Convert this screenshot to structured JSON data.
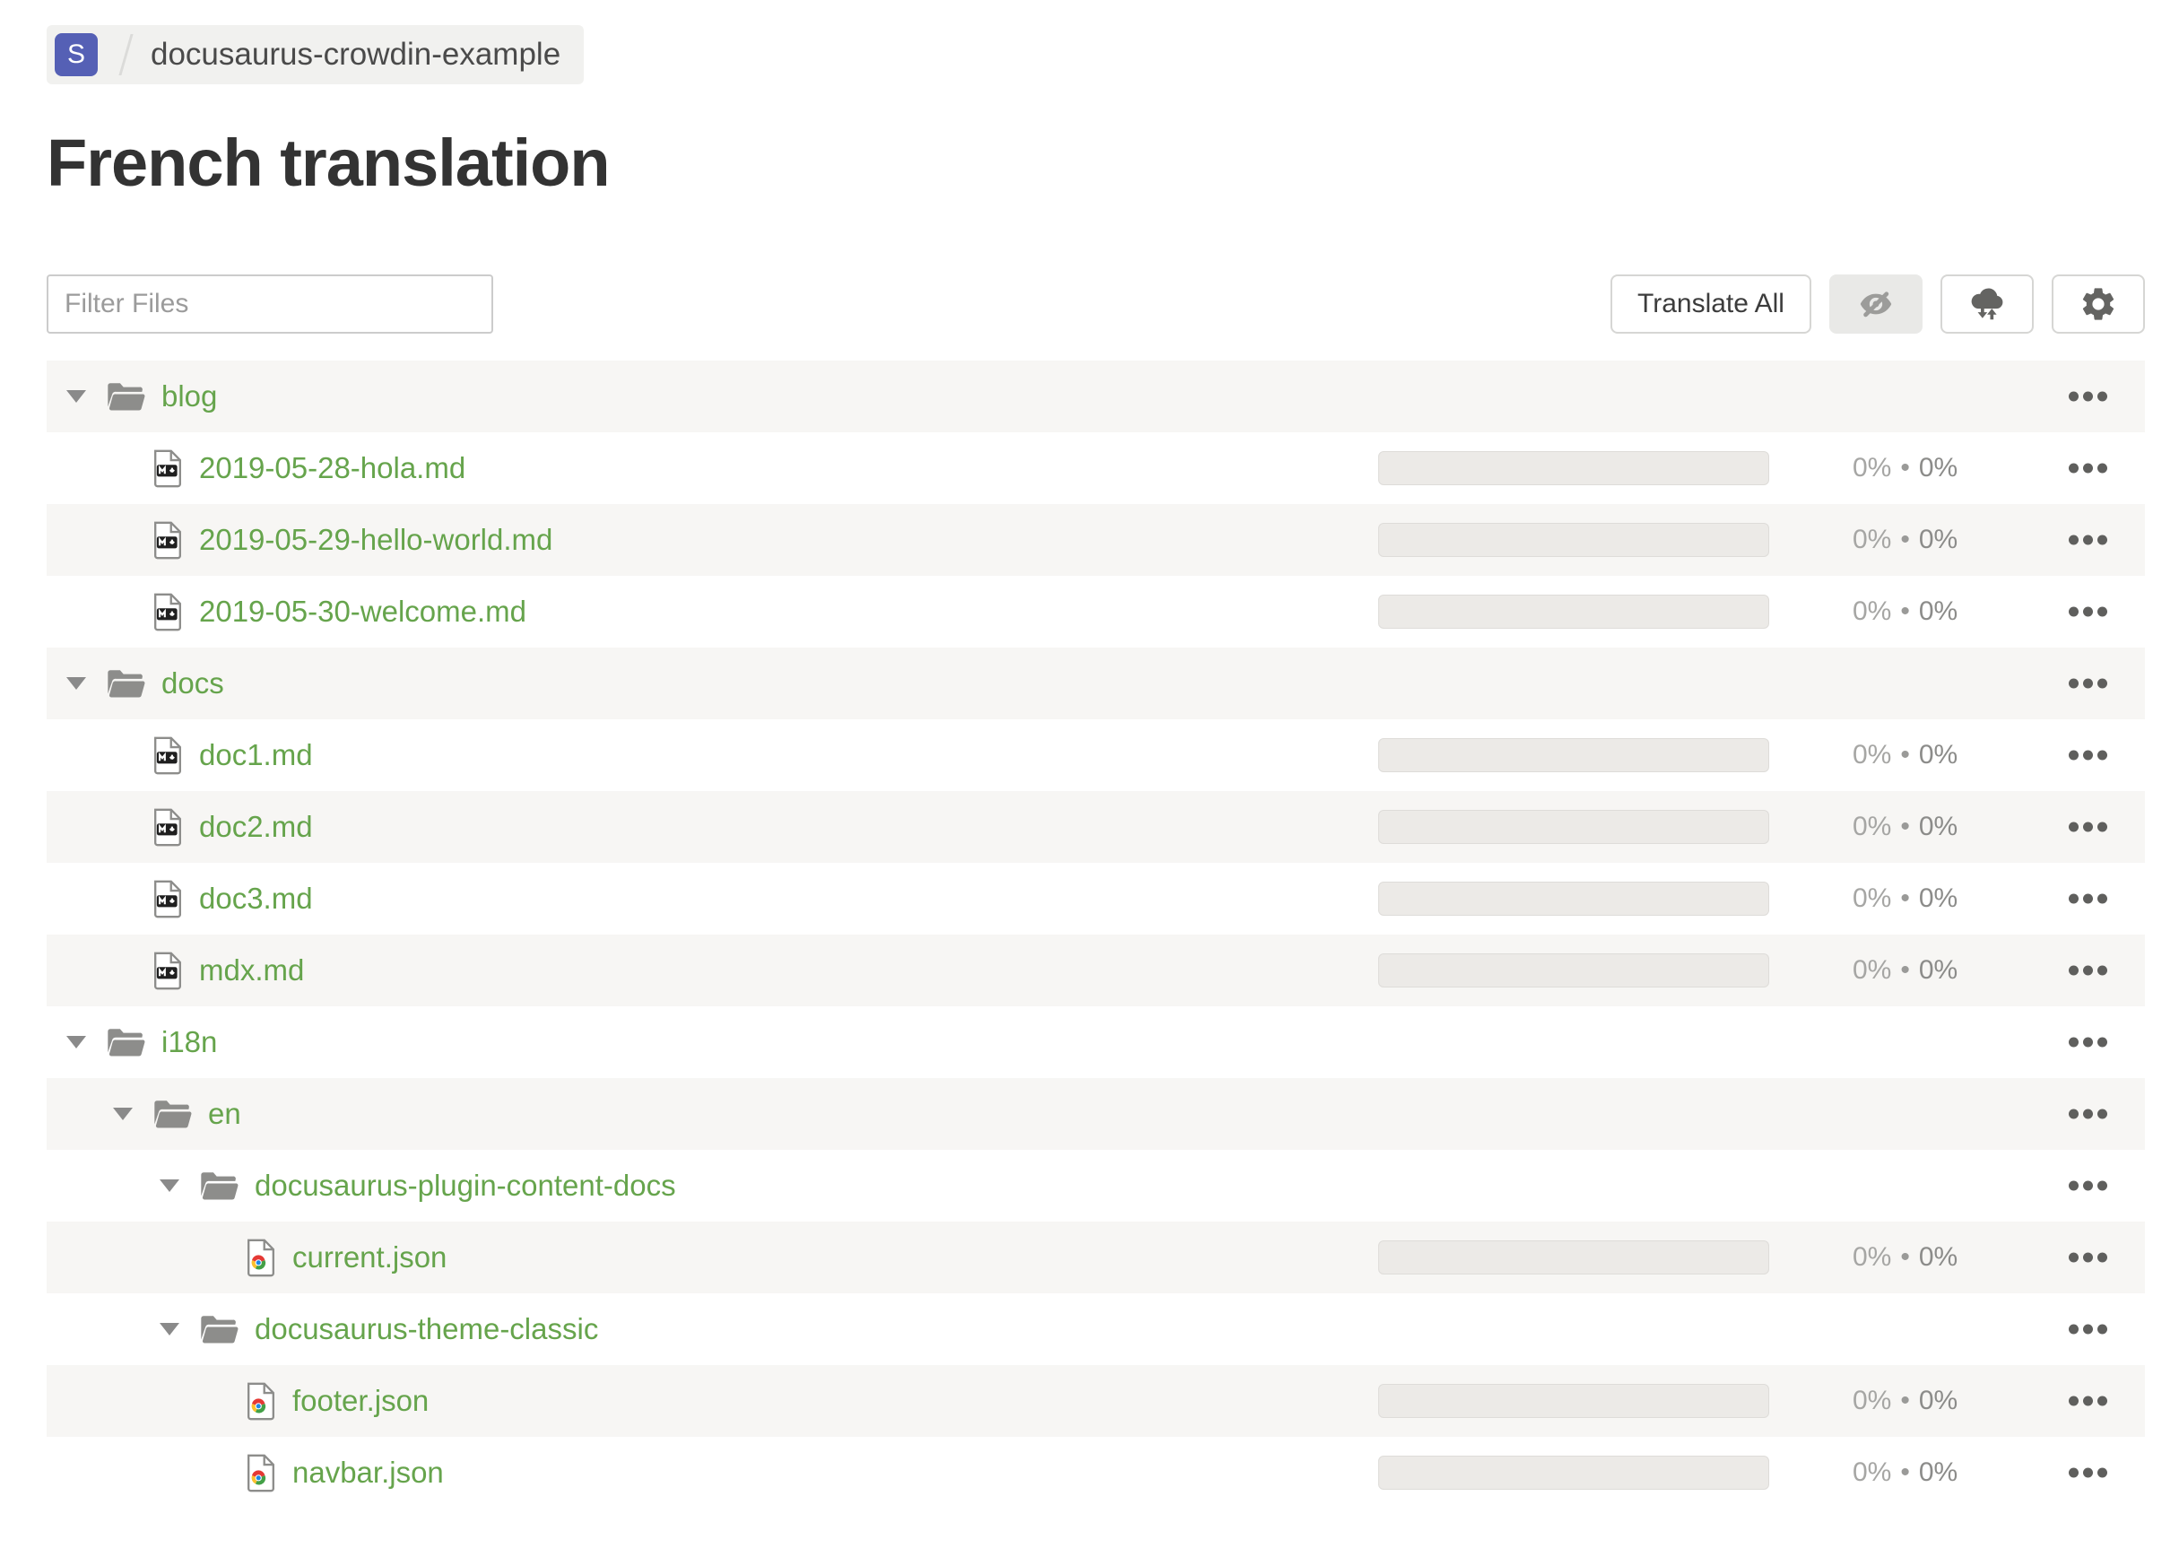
{
  "breadcrumb": {
    "logo_letter": "S",
    "separator": "/",
    "project_name": "docusaurus-crowdin-example"
  },
  "page": {
    "title": "French translation"
  },
  "toolbar": {
    "filter_placeholder": "Filter Files",
    "translate_all_label": "Translate All"
  },
  "icons": {
    "triangle-down-icon": "▾",
    "folder-icon": "open-folder-shape",
    "markdown-file-icon": "page-with-M↓-badge",
    "json-file-icon": "page-with-chrome-logo",
    "eye-off-icon": "crossed-out-eye",
    "cloud-sync-icon": "cloud-with-down-up-arrows",
    "gear-icon": "⚙",
    "ellipsis-icon": "•••"
  },
  "colors": {
    "link_green": "#66a44c",
    "logo_indigo": "#5560b5",
    "row_stripe": "#f7f6f4",
    "progress_track": "#eceae7"
  },
  "tree": {
    "percent_separator": "•",
    "rows": [
      {
        "kind": "folder",
        "level": 0,
        "name": "blog"
      },
      {
        "kind": "file",
        "level": 1,
        "file_type": "markdown",
        "name": "2019-05-28-hola.md",
        "translated": "0%",
        "approved": "0%"
      },
      {
        "kind": "file",
        "level": 1,
        "file_type": "markdown",
        "name": "2019-05-29-hello-world.md",
        "translated": "0%",
        "approved": "0%"
      },
      {
        "kind": "file",
        "level": 1,
        "file_type": "markdown",
        "name": "2019-05-30-welcome.md",
        "translated": "0%",
        "approved": "0%"
      },
      {
        "kind": "folder",
        "level": 0,
        "name": "docs"
      },
      {
        "kind": "file",
        "level": 1,
        "file_type": "markdown",
        "name": "doc1.md",
        "translated": "0%",
        "approved": "0%"
      },
      {
        "kind": "file",
        "level": 1,
        "file_type": "markdown",
        "name": "doc2.md",
        "translated": "0%",
        "approved": "0%"
      },
      {
        "kind": "file",
        "level": 1,
        "file_type": "markdown",
        "name": "doc3.md",
        "translated": "0%",
        "approved": "0%"
      },
      {
        "kind": "file",
        "level": 1,
        "file_type": "markdown",
        "name": "mdx.md",
        "translated": "0%",
        "approved": "0%"
      },
      {
        "kind": "folder",
        "level": 0,
        "name": "i18n"
      },
      {
        "kind": "folder",
        "level": 1,
        "name": "en"
      },
      {
        "kind": "folder",
        "level": 2,
        "name": "docusaurus-plugin-content-docs"
      },
      {
        "kind": "file",
        "level": 3,
        "file_type": "json",
        "name": "current.json",
        "translated": "0%",
        "approved": "0%"
      },
      {
        "kind": "folder",
        "level": 2,
        "name": "docusaurus-theme-classic"
      },
      {
        "kind": "file",
        "level": 3,
        "file_type": "json",
        "name": "footer.json",
        "translated": "0%",
        "approved": "0%"
      },
      {
        "kind": "file",
        "level": 3,
        "file_type": "json",
        "name": "navbar.json",
        "translated": "0%",
        "approved": "0%"
      }
    ]
  }
}
